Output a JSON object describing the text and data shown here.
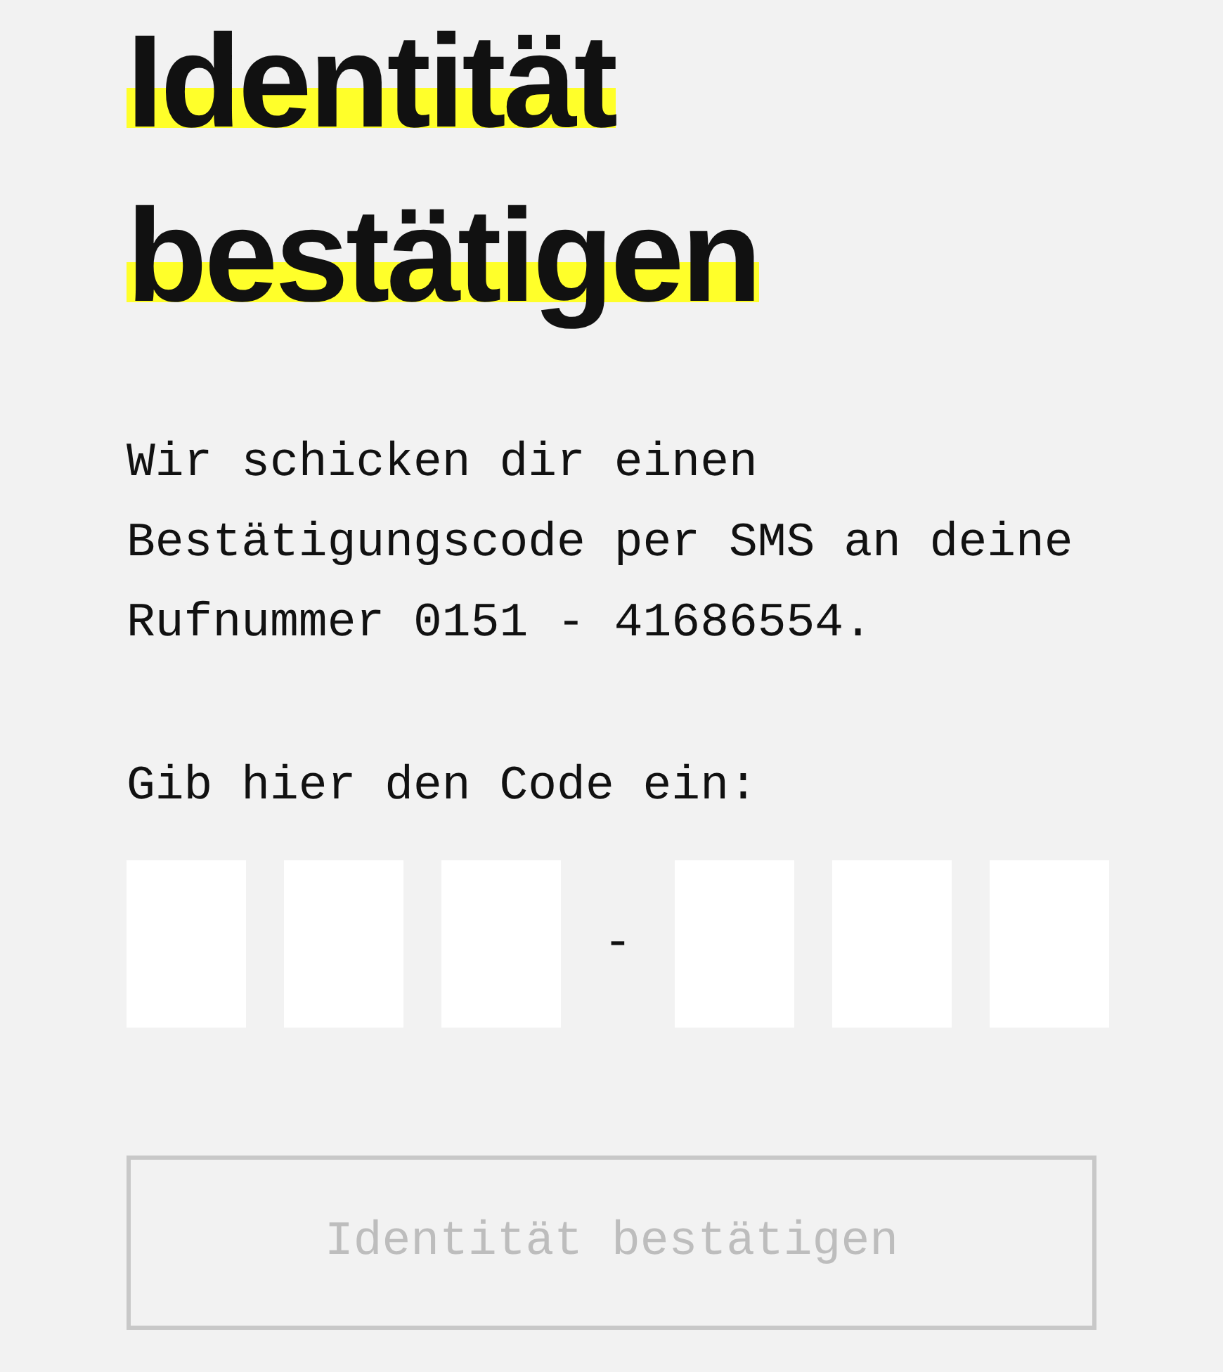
{
  "heading": "Identität bestätigen",
  "intro": "Wir schicken dir einen Bestätigungscode per SMS an deine Rufnummer 0151 - 41686554.",
  "code_label": "Gib hier den Code ein:",
  "code_fields": [
    {
      "kind": "digit"
    },
    {
      "kind": "digit"
    },
    {
      "kind": "digit"
    },
    {
      "kind": "separator",
      "text": "-"
    },
    {
      "kind": "digit"
    },
    {
      "kind": "digit"
    },
    {
      "kind": "digit"
    }
  ],
  "submit_button": {
    "label": "Identität bestätigen",
    "disabled": true
  }
}
